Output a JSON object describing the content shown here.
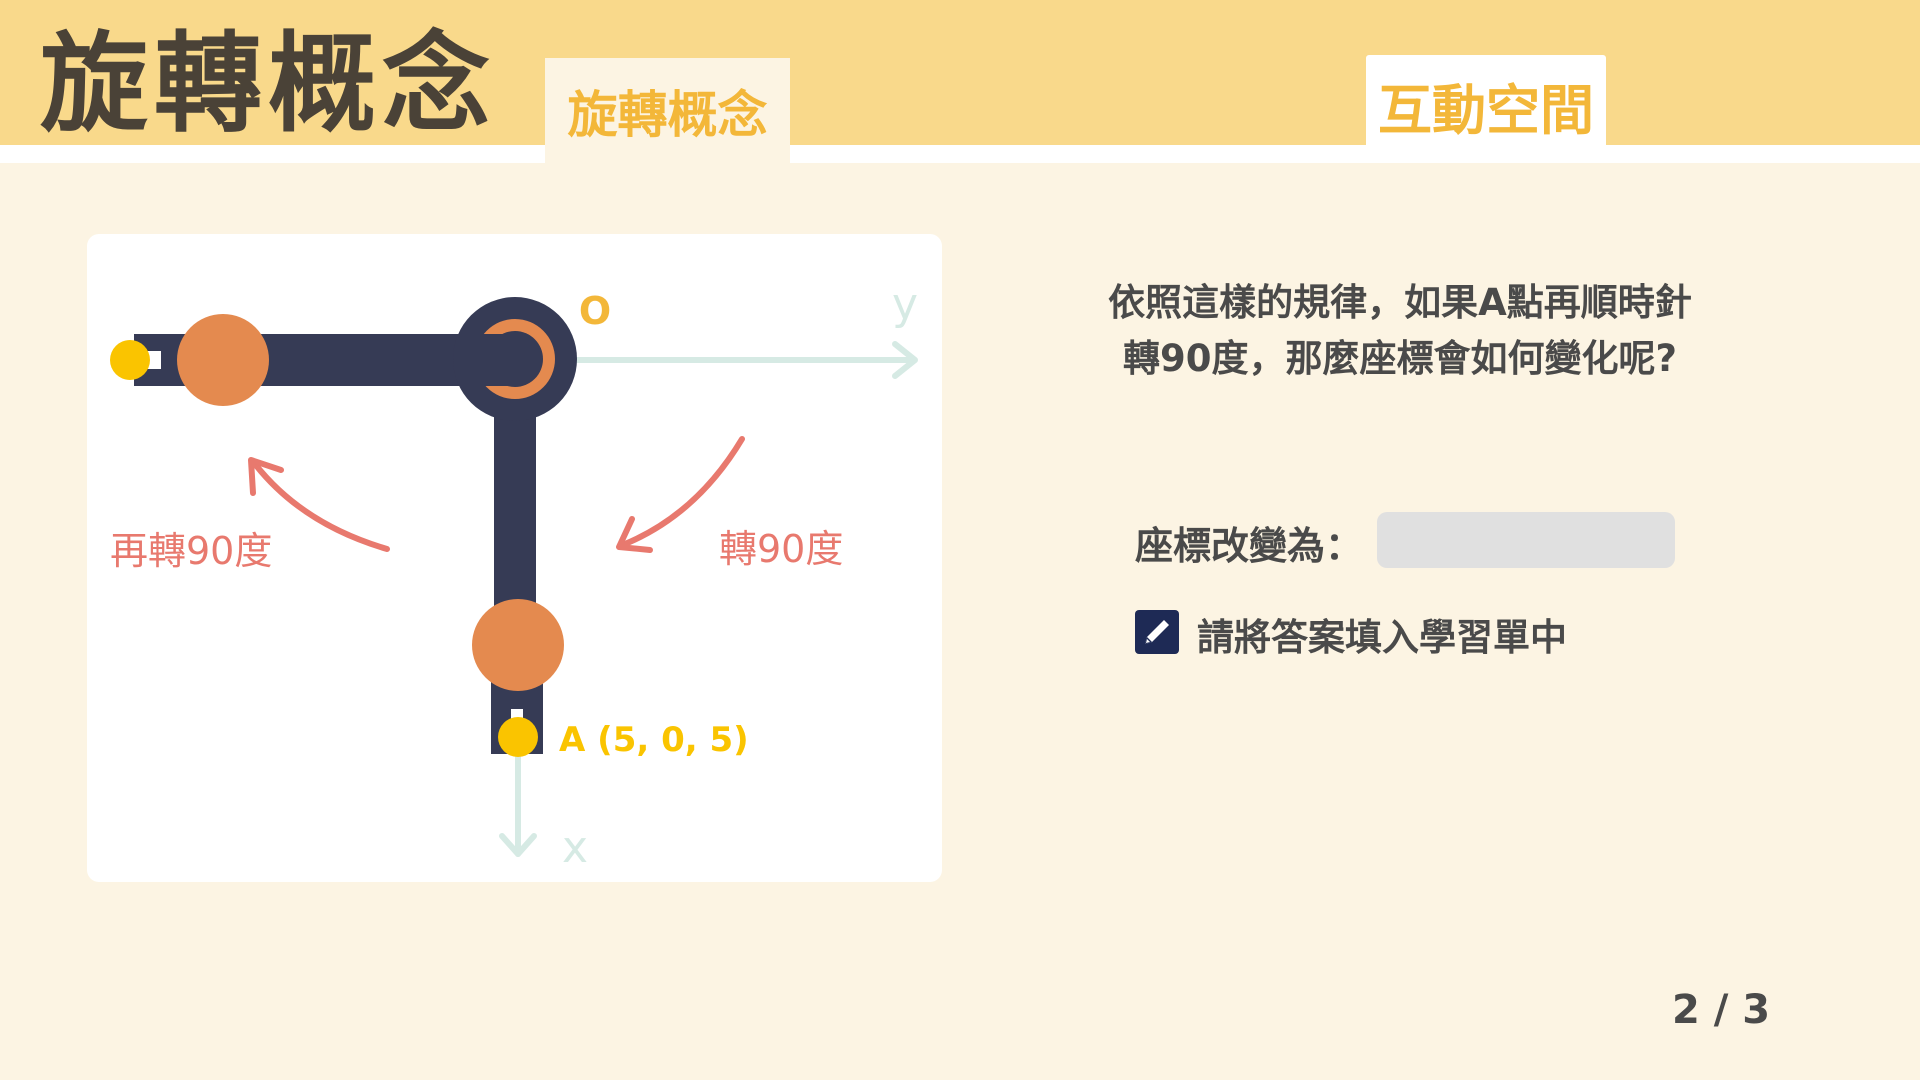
{
  "header": {
    "title": "旋轉概念",
    "tabs": [
      {
        "label": "旋轉概念"
      },
      {
        "label": "互動空間"
      }
    ]
  },
  "diagram": {
    "origin_label": "O",
    "axis_x_label": "x",
    "axis_y_label": "y",
    "point_a_label": "A (5, 0, 5)",
    "rotate_label": "轉90度",
    "rotate_again_label": "再轉90度"
  },
  "question": {
    "line1": "依照這樣的規律，如果A點再順時針",
    "line2": "轉90度，那麼座標會如何變化呢?"
  },
  "answer": {
    "label": "座標改變為：",
    "value": "",
    "placeholder": ""
  },
  "note": {
    "icon": "pencil-icon",
    "text": "請將答案填入學習單中"
  },
  "pagination": {
    "text": "2 / 3"
  },
  "colors": {
    "header_bg": "#f9d98b",
    "page_bg": "#fcf4e3",
    "accent_yellow": "#f3b739",
    "arm_dark": "#363b55",
    "joint_orange": "#e48a4f",
    "point_yellow": "#fac400",
    "arrow_salmon": "#e8796e",
    "axis_mint": "#d6eae4"
  }
}
